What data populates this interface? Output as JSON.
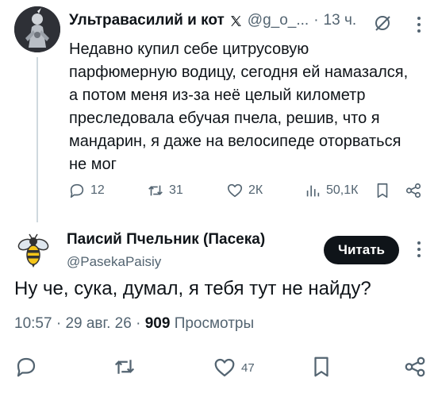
{
  "tweet1": {
    "author_name": "Ультравасилий и кот",
    "handle": "@g_o_...",
    "separator": "·",
    "time": "13 ч.",
    "text_lines": [
      "Недавно купил себе цитрусовую",
      "парфюмерную водицу, сегодня ей намазался,",
      "а потом меня из-за неё целый километр",
      "преследовала ебучая пчела, решив, что я",
      "мандарин, я даже на велосипеде оторваться",
      "не мог"
    ],
    "actions": {
      "replies": "12",
      "reposts": "31",
      "likes": "2К",
      "views": "50,1К"
    }
  },
  "tweet2": {
    "author_name": "Паисий Пчельник (Пасека)",
    "handle": "@PasekaPaisiy",
    "read_button": "Читать",
    "text": "Ну че, сука, думал, я тебя тут не найду?",
    "time": "10:57",
    "dot1": "·",
    "date": "29 авг. 26",
    "dot2": "·",
    "views_count": "909",
    "views_label": "Просмотры",
    "likes": "47"
  },
  "colors": {
    "text": "#0f1419",
    "secondary": "#536471",
    "line": "#cfd9de",
    "button_bg": "#0f1419"
  }
}
